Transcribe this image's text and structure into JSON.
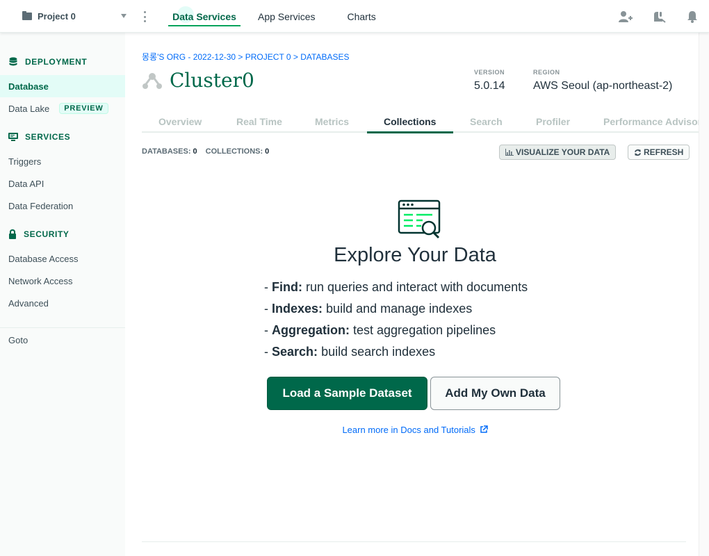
{
  "topbar": {
    "project_name": "Project 0",
    "tabs": [
      {
        "label": "Data Services"
      },
      {
        "label": "App Services"
      },
      {
        "label": "Charts"
      }
    ]
  },
  "sidebar": {
    "deployment_label": "DEPLOYMENT",
    "database_label": "Database",
    "data_lake_label": "Data Lake",
    "preview_badge": "PREVIEW",
    "services_label": "SERVICES",
    "triggers_label": "Triggers",
    "data_api_label": "Data API",
    "data_federation_label": "Data Federation",
    "security_label": "SECURITY",
    "database_access_label": "Database Access",
    "network_access_label": "Network Access",
    "advanced_label": "Advanced",
    "goto_label": "Goto"
  },
  "main": {
    "breadcrumb": "몽롱'S ORG - 2022-12-30 > PROJECT 0 > DATABASES",
    "cluster_name": "Cluster0",
    "version_label": "VERSION",
    "version_value": "5.0.14",
    "region_label": "REGION",
    "region_value": "AWS Seoul (ap-northeast-2)",
    "tabs": [
      {
        "label": "Overview"
      },
      {
        "label": "Real Time"
      },
      {
        "label": "Metrics"
      },
      {
        "label": "Collections"
      },
      {
        "label": "Search"
      },
      {
        "label": "Profiler"
      },
      {
        "label": "Performance Advisor"
      }
    ],
    "active_tab": "Collections",
    "databases_label": "DATABASES:",
    "databases_count": "0",
    "collections_label": "COLLECTIONS:",
    "collections_count": "0",
    "visualize_label": "VISUALIZE YOUR DATA",
    "refresh_label": "REFRESH"
  },
  "empty_state": {
    "title": "Explore Your Data",
    "features": [
      {
        "term": "Find:",
        "text": "run queries and interact with documents"
      },
      {
        "term": "Indexes:",
        "text": "build and manage indexes"
      },
      {
        "term": "Aggregation:",
        "text": "test aggregation pipelines"
      },
      {
        "term": "Search:",
        "text": "build search indexes"
      }
    ],
    "primary_button": "Load a Sample Dataset",
    "secondary_button": "Add My Own Data",
    "learn_link": "Learn more in Docs and Tutorials"
  },
  "colors": {
    "brand_green": "#00684a",
    "link_blue": "#016bf8",
    "active_bg": "#e3fcf7"
  }
}
